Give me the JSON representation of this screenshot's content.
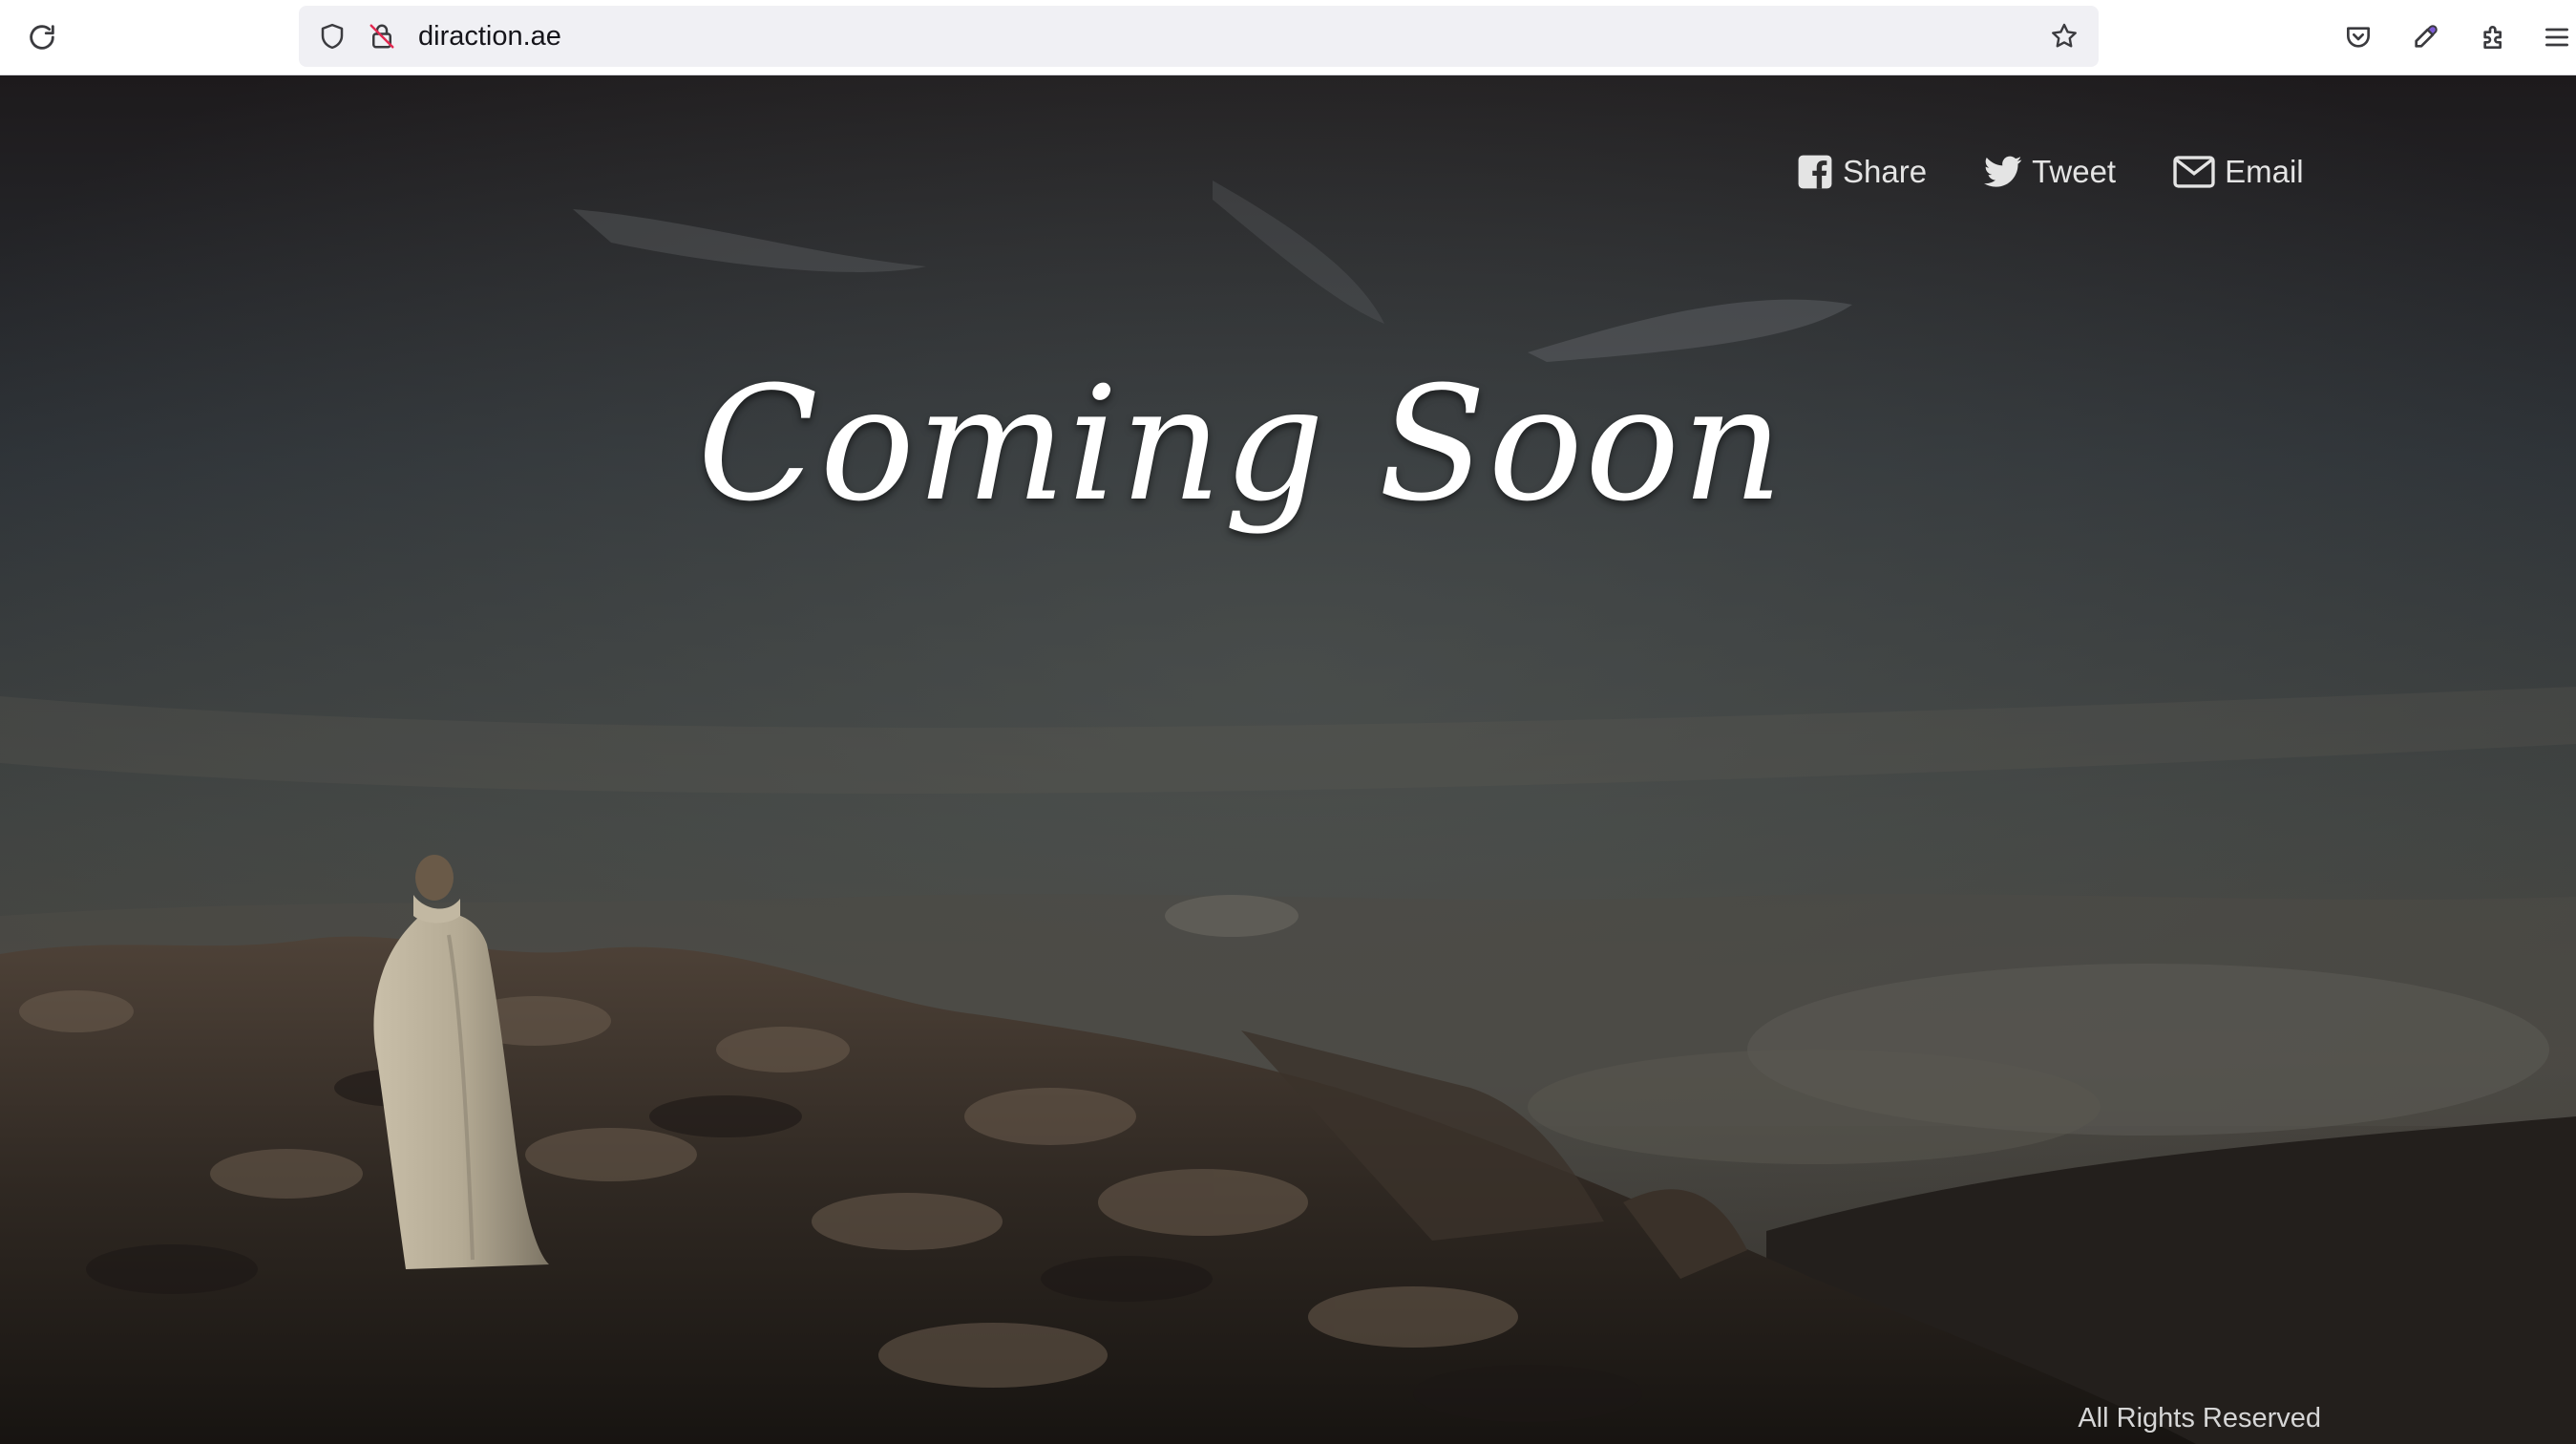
{
  "browser": {
    "url": "diraction.ae",
    "icons": {
      "reload": "reload-icon",
      "tracking_protection": "shield-icon",
      "connection": "insecure-lock-icon",
      "bookmark": "star-icon",
      "pocket": "pocket-icon",
      "eyedropper": "eyedropper-icon",
      "extensions": "puzzle-icon",
      "menu": "hamburger-menu-icon"
    }
  },
  "page": {
    "share": [
      {
        "label": "Share",
        "icon": "facebook-icon"
      },
      {
        "label": "Tweet",
        "icon": "twitter-icon"
      },
      {
        "label": "Email",
        "icon": "envelope-icon"
      }
    ],
    "headline": "Coming Soon",
    "footer": "All Rights Reserved"
  },
  "colors": {
    "toolbar_bg": "#ffffff",
    "urlbar_bg": "#f0f0f4",
    "headline": "#ffffff",
    "share_text": "#e4e4e4"
  }
}
